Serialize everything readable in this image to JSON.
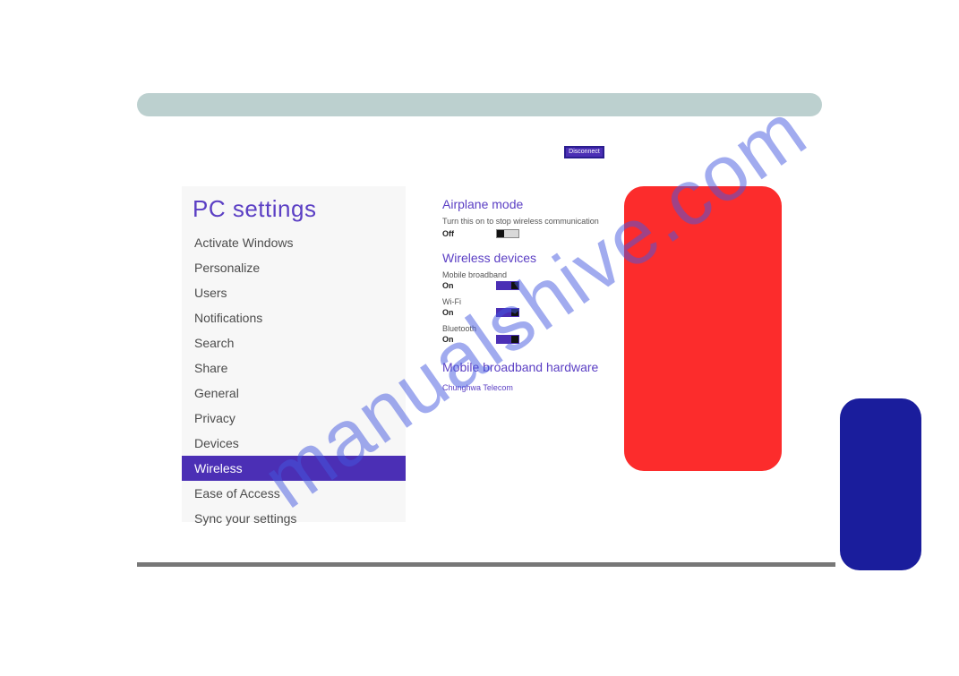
{
  "topbar": {},
  "disconnect": {
    "label": "Disconnect"
  },
  "sidebar": {
    "title": "PC settings",
    "items": [
      {
        "label": "Activate Windows",
        "selected": false
      },
      {
        "label": "Personalize",
        "selected": false
      },
      {
        "label": "Users",
        "selected": false
      },
      {
        "label": "Notifications",
        "selected": false
      },
      {
        "label": "Search",
        "selected": false
      },
      {
        "label": "Share",
        "selected": false
      },
      {
        "label": "General",
        "selected": false
      },
      {
        "label": "Privacy",
        "selected": false
      },
      {
        "label": "Devices",
        "selected": false
      },
      {
        "label": "Wireless",
        "selected": true
      },
      {
        "label": "Ease of Access",
        "selected": false
      },
      {
        "label": "Sync your settings",
        "selected": false
      }
    ]
  },
  "airplane": {
    "heading": "Airplane mode",
    "desc": "Turn this on to stop wireless communication",
    "state": "Off"
  },
  "wireless": {
    "heading": "Wireless devices",
    "devices": [
      {
        "name": "Mobile broadband",
        "state": "On"
      },
      {
        "name": "Wi-Fi",
        "state": "On"
      },
      {
        "name": "Bluetooth",
        "state": "On"
      }
    ]
  },
  "mbhw": {
    "heading": "Mobile broadband hardware",
    "provider": "Chunghwa Telecom"
  },
  "watermark": "manualshive.com"
}
